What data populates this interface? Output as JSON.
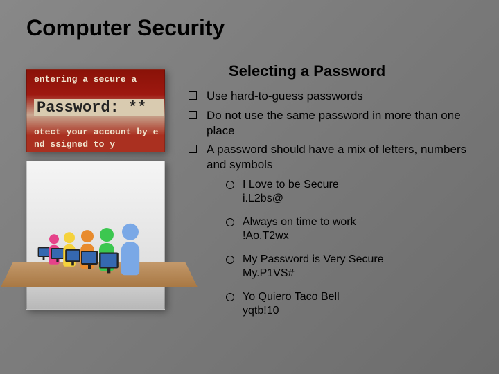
{
  "title": "Computer Security",
  "subtitle": "Selecting a Password",
  "bullets": [
    {
      "text": "Use hard-to-guess passwords"
    },
    {
      "text": "Do not use the same password in more than one place"
    },
    {
      "text": "A password should have a mix of letters, numbers and symbols"
    }
  ],
  "examples": [
    {
      "phrase": "I Love to be Secure",
      "code": "i.L2bs@"
    },
    {
      "phrase": "Always on time to work",
      "code": "!Ao.T2wx"
    },
    {
      "phrase": "My Password is Very Secure",
      "code": "My.P1VS#"
    },
    {
      "phrase": "Yo Quiero Taco Bell",
      "code": "yqtb!10"
    }
  ],
  "image1_lines": {
    "l1": "entering a secure a",
    "l2": "Password: **",
    "l3": "otect your account by e",
    "l4": "nd  ssigned to y"
  }
}
